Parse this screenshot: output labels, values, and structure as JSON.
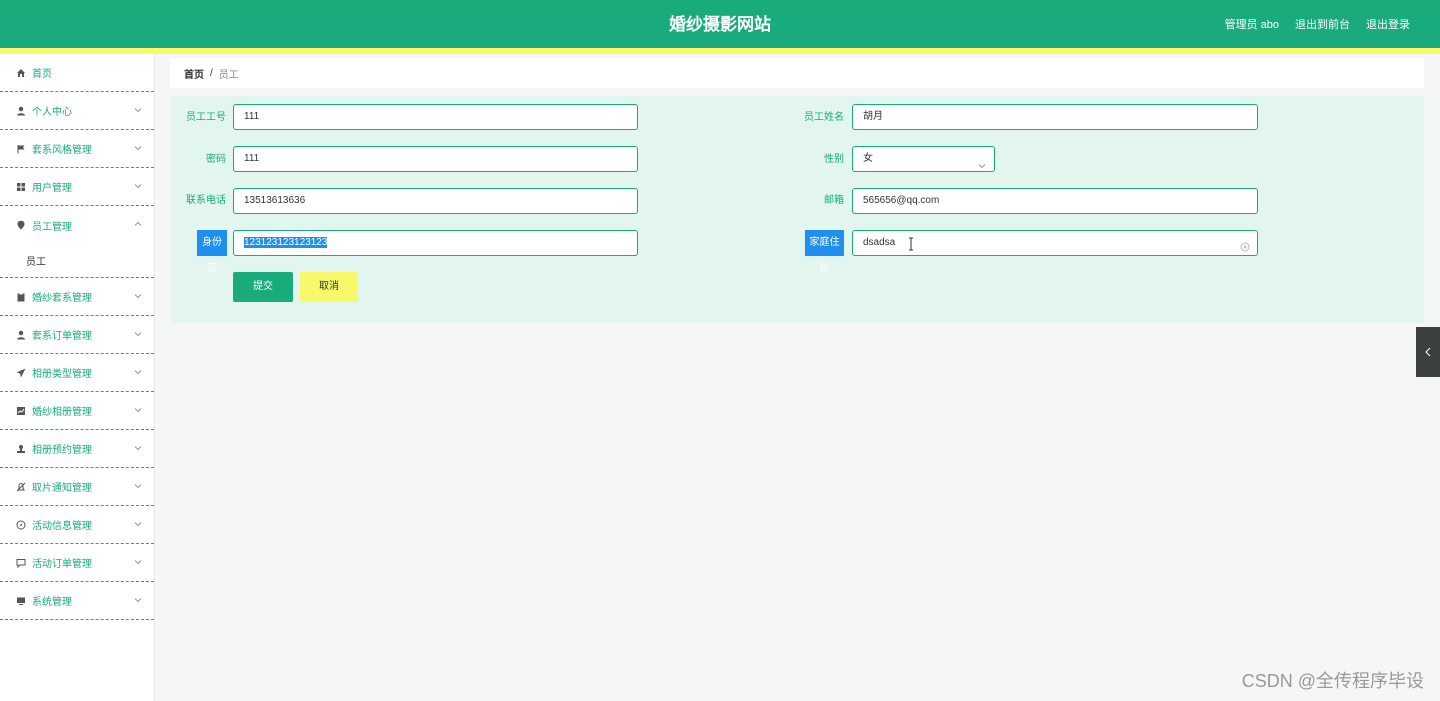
{
  "header": {
    "title": "婚纱摄影网站",
    "user_label": "管理员 abo",
    "front_link": "退出到前台",
    "logout_link": "退出登录"
  },
  "sidebar": {
    "items": [
      {
        "label": "首页",
        "icon": "home-icon"
      },
      {
        "label": "个人中心",
        "icon": "user-icon"
      },
      {
        "label": "套系风格管理",
        "icon": "flag-icon"
      },
      {
        "label": "用户管理",
        "icon": "grid-icon"
      },
      {
        "label": "员工管理",
        "icon": "location-icon",
        "expanded": true,
        "sub": [
          {
            "label": "员工"
          }
        ]
      },
      {
        "label": "婚纱套系管理",
        "icon": "clipboard-icon"
      },
      {
        "label": "套系订单管理",
        "icon": "user-icon"
      },
      {
        "label": "相册类型管理",
        "icon": "send-icon"
      },
      {
        "label": "婚纱相册管理",
        "icon": "chart-icon"
      },
      {
        "label": "相册预约管理",
        "icon": "stamp-icon"
      },
      {
        "label": "取片通知管理",
        "icon": "bell-off-icon"
      },
      {
        "label": "活动信息管理",
        "icon": "compass-icon"
      },
      {
        "label": "活动订单管理",
        "icon": "chat-icon"
      },
      {
        "label": "系统管理",
        "icon": "monitor-icon"
      }
    ]
  },
  "breadcrumb": {
    "home": "首页",
    "separator": "/",
    "current": "员工"
  },
  "form": {
    "employee_no": {
      "label": "员工工号",
      "value": "111"
    },
    "employee_name": {
      "label": "员工姓名",
      "value": "胡月"
    },
    "password": {
      "label": "密码",
      "value": "111"
    },
    "gender": {
      "label": "性别",
      "value": "女"
    },
    "phone": {
      "label": "联系电话",
      "value": "13513613636"
    },
    "email": {
      "label": "邮箱",
      "value": "565656@qq.com"
    },
    "id_card": {
      "label": "身份证",
      "value": "123123123123123"
    },
    "address": {
      "label": "家庭住址",
      "value": "dsadsa"
    },
    "submit_label": "提交",
    "cancel_label": "取消"
  },
  "watermark": "CSDN @全传程序毕设",
  "colors": {
    "primary": "#1aab7c",
    "accent_yellow": "#f7f86a",
    "highlight_blue": "#1f8ff0"
  }
}
